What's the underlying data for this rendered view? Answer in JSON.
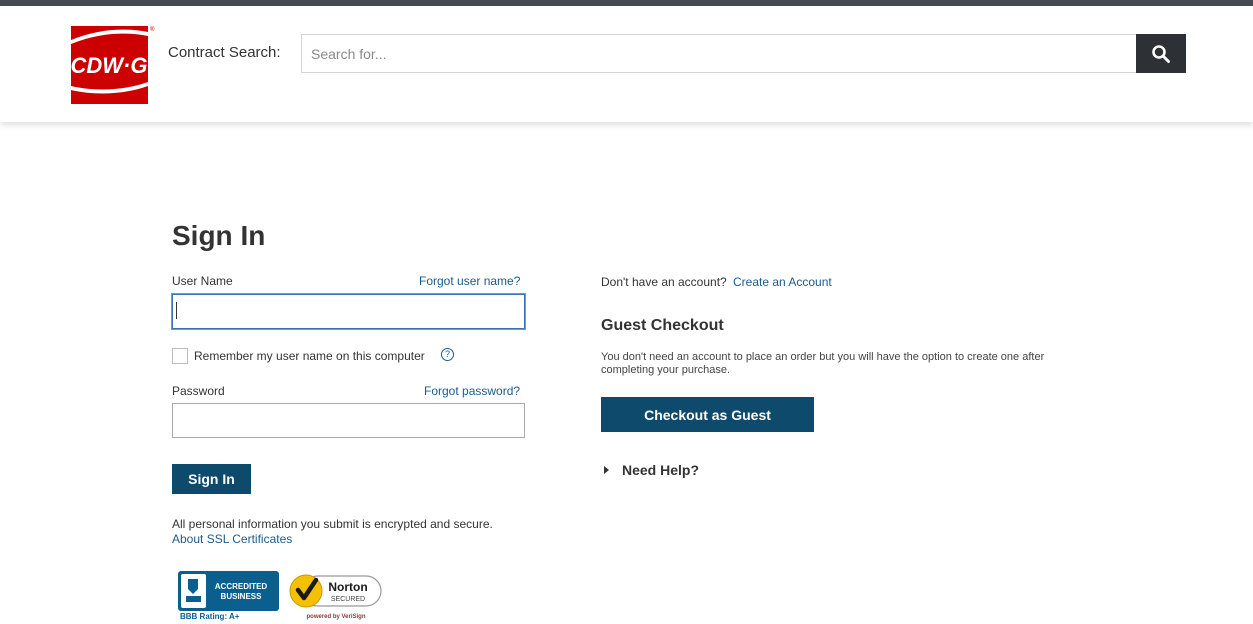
{
  "header": {
    "logo_text": "CDW·G",
    "search_label": "Contract Search:",
    "search_placeholder": "Search for...",
    "search_icon": "search-icon"
  },
  "signin": {
    "title": "Sign In",
    "username_label": "User Name",
    "forgot_username": "Forgot user name?",
    "username_value": "",
    "remember_label": "Remember my user name on this computer",
    "help_icon_text": "?",
    "password_label": "Password",
    "forgot_password": "Forgot password?",
    "password_value": "",
    "signin_button": "Sign In",
    "secure_text": "All personal information you submit is encrypted and secure.",
    "ssl_link": "About SSL Certificates"
  },
  "account": {
    "no_account_text": "Don't have an account?",
    "create_link": "Create an Account",
    "guest_title": "Guest Checkout",
    "guest_desc": "You don't need an account to place an order but you will have the option to create one after completing your purchase.",
    "guest_button": "Checkout as Guest",
    "need_help": "Need Help?"
  },
  "badges": {
    "bbb_line1": "ACCREDITED",
    "bbb_line2": "BUSINESS",
    "bbb_rating": "BBB Rating: A+",
    "norton_name": "Norton",
    "norton_secured": "SECURED",
    "norton_powered": "powered by VeriSign"
  },
  "colors": {
    "brand_red": "#cc0000",
    "primary_button": "#0d4a6c",
    "link": "#1a5c8e",
    "search_button": "#2d3035"
  }
}
